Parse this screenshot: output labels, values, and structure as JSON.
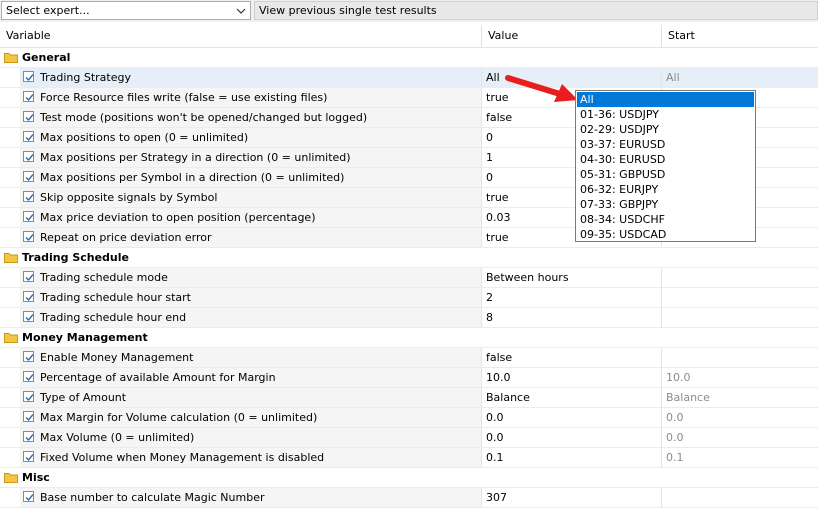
{
  "toolbar": {
    "expert_select_value": "Select expert...",
    "view_button_label": "View previous single test results"
  },
  "columns": {
    "variable": "Variable",
    "value": "Value",
    "start": "Start"
  },
  "groups": [
    {
      "title": "General",
      "params": [
        {
          "name": "Trading Strategy",
          "value": "All",
          "start": "All",
          "checked": true,
          "selected": true
        },
        {
          "name": "Force Resource files write (false = use existing files)",
          "value": "true",
          "start": "",
          "checked": true
        },
        {
          "name": "Test mode (positions won't be opened/changed but logged)",
          "value": "false",
          "start": "",
          "checked": true
        },
        {
          "name": "Max positions to open (0 = unlimited)",
          "value": "0",
          "start": "",
          "checked": true
        },
        {
          "name": "Max positions per Strategy in a direction (0 = unlimited)",
          "value": "1",
          "start": "",
          "checked": true
        },
        {
          "name": "Max positions per Symbol in a direction (0 = unlimited)",
          "value": "0",
          "start": "",
          "checked": true
        },
        {
          "name": "Skip opposite signals by Symbol",
          "value": "true",
          "start": "",
          "checked": true
        },
        {
          "name": "Max price deviation to open position (percentage)",
          "value": "0.03",
          "start": "",
          "checked": true
        },
        {
          "name": "Repeat on price deviation error",
          "value": "true",
          "start": "",
          "checked": true
        }
      ]
    },
    {
      "title": "Trading Schedule",
      "params": [
        {
          "name": "Trading schedule mode",
          "value": "Between hours",
          "start": "",
          "checked": true
        },
        {
          "name": "Trading schedule hour start",
          "value": "2",
          "start": "",
          "checked": true
        },
        {
          "name": "Trading schedule hour end",
          "value": "8",
          "start": "",
          "checked": true
        }
      ]
    },
    {
      "title": "Money Management",
      "params": [
        {
          "name": "Enable Money Management",
          "value": "false",
          "start": "",
          "checked": true
        },
        {
          "name": "Percentage of available Amount for Margin",
          "value": "10.0",
          "start": "10.0",
          "checked": true
        },
        {
          "name": "Type of Amount",
          "value": "Balance",
          "start": "Balance",
          "checked": true
        },
        {
          "name": "Max Margin for Volume calculation (0 = unlimited)",
          "value": "0.0",
          "start": "0.0",
          "checked": true
        },
        {
          "name": "Max Volume (0 = unlimited)",
          "value": "0.0",
          "start": "0.0",
          "checked": true
        },
        {
          "name": "Fixed Volume when Money Management is disabled",
          "value": "0.1",
          "start": "0.1",
          "checked": true
        }
      ]
    },
    {
      "title": "Misc",
      "params": [
        {
          "name": "Base number to calculate Magic Number",
          "value": "307",
          "start": "",
          "checked": true
        }
      ]
    }
  ],
  "dropdown": {
    "options": [
      "All",
      "01-36: USDJPY",
      "02-29: USDJPY",
      "03-37: EURUSD",
      "04-30: EURUSD",
      "05-31: GBPUSD",
      "06-32: EURJPY",
      "07-33: GBPJPY",
      "08-34: USDCHF",
      "09-35: USDCAD"
    ],
    "selected_index": 0
  },
  "colors": {
    "accent": "#0078d7",
    "arrow": "#e81e1e",
    "folder": "#f5c542",
    "check": "#2a6fb5"
  },
  "icons": [
    "chevron-down-icon",
    "folder-icon",
    "checkbox-checked-icon",
    "red-arrow-icon"
  ]
}
